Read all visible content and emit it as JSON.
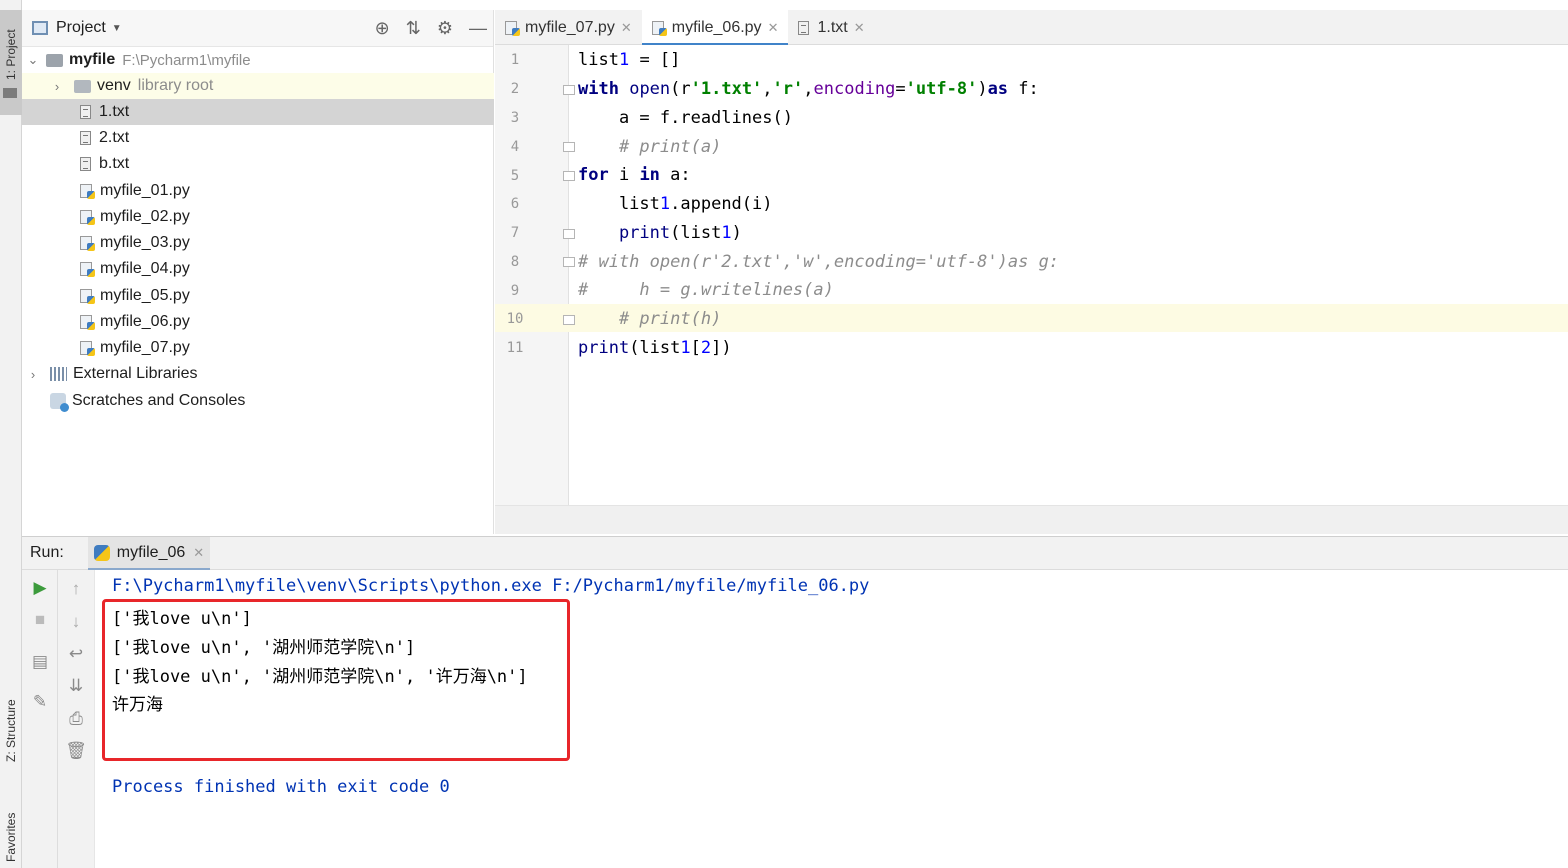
{
  "left_strip": {
    "project_tab": "1: Project",
    "structure_tab": "Z: Structure",
    "favorites_tab": "Favorites"
  },
  "project": {
    "title": "Project",
    "root": {
      "name": "myfile",
      "path": "F:\\Pycharm1\\myfile"
    },
    "venv": {
      "name": "venv",
      "note": "library root"
    },
    "files": [
      "1.txt",
      "2.txt",
      "b.txt",
      "myfile_01.py",
      "myfile_02.py",
      "myfile_03.py",
      "myfile_04.py",
      "myfile_05.py",
      "myfile_06.py",
      "myfile_07.py"
    ],
    "selected_file": "1.txt",
    "external_libraries": "External Libraries",
    "scratches": "Scratches and Consoles"
  },
  "editor_tabs": [
    {
      "label": "myfile_07.py",
      "active": false
    },
    {
      "label": "myfile_06.py",
      "active": true
    },
    {
      "label": "1.txt",
      "active": false
    }
  ],
  "code": {
    "line_numbers": [
      "1",
      "2",
      "3",
      "4",
      "5",
      "6",
      "7",
      "8",
      "9",
      "10",
      "11"
    ],
    "current_line": "10",
    "lines": [
      "list1 = []",
      "with open(r'1.txt','r',encoding='utf-8')as f:",
      "    a = f.readlines()",
      "    # print(a)",
      "for i in a:",
      "    list1.append(i)",
      "    print(list1)",
      "# with open(r'2.txt','w',encoding='utf-8')as g:",
      "#     h = g.writelines(a)",
      "    # print(h)",
      "print(list1[2])"
    ]
  },
  "run": {
    "label": "Run:",
    "tab": "myfile_06",
    "command": "F:\\Pycharm1\\myfile\\venv\\Scripts\\python.exe F:/Pycharm1/myfile/myfile_06.py",
    "output": [
      "['我love u\\n']",
      "['我love u\\n', '湖州师范学院\\n']",
      "['我love u\\n', '湖州师范学院\\n', '许万海\\n']",
      "许万海"
    ],
    "exit_message": "Process finished with exit code 0"
  },
  "colors": {
    "highlight_box": "#e8262a",
    "keyword": "#000080",
    "string": "#008000",
    "comment": "#8c8c8c",
    "console_blue": "#0033b3"
  }
}
